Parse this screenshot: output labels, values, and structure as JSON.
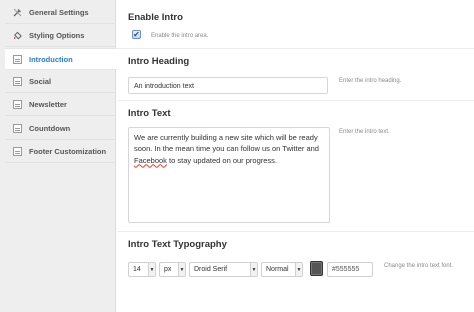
{
  "sidebar": {
    "items": [
      {
        "label": "General Settings",
        "icon": "wrench-icon"
      },
      {
        "label": "Styling Options",
        "icon": "paint-bucket-icon"
      },
      {
        "label": "Introduction",
        "icon": "grid-icon"
      },
      {
        "label": "Social",
        "icon": "grid-icon"
      },
      {
        "label": "Newsletter",
        "icon": "grid-icon"
      },
      {
        "label": "Countdown",
        "icon": "grid-icon"
      },
      {
        "label": "Footer Customization",
        "icon": "grid-icon"
      }
    ],
    "active_index": 2,
    "active_color": "#2a7fc0"
  },
  "enable_intro": {
    "title": "Enable Intro",
    "checkbox_label": "Enable the intro area.",
    "checked": true
  },
  "intro_heading": {
    "title": "Intro Heading",
    "value": "An introduction text",
    "hint": "Enter the intro heading."
  },
  "intro_text": {
    "title": "Intro Text",
    "value_before": "We are currently building a new site which will be ready soon. In the mean time you can follow us on Twitter and ",
    "value_misspelled": "Facebook",
    "value_after": " to stay updated on our progress.",
    "hint": "Enter the intro text."
  },
  "typography": {
    "title": "Intro Text Typography",
    "size": "14",
    "unit": "px",
    "font": "Droid Serif",
    "weight": "Normal",
    "color": "#555555",
    "hint": "Change the intro text font."
  }
}
